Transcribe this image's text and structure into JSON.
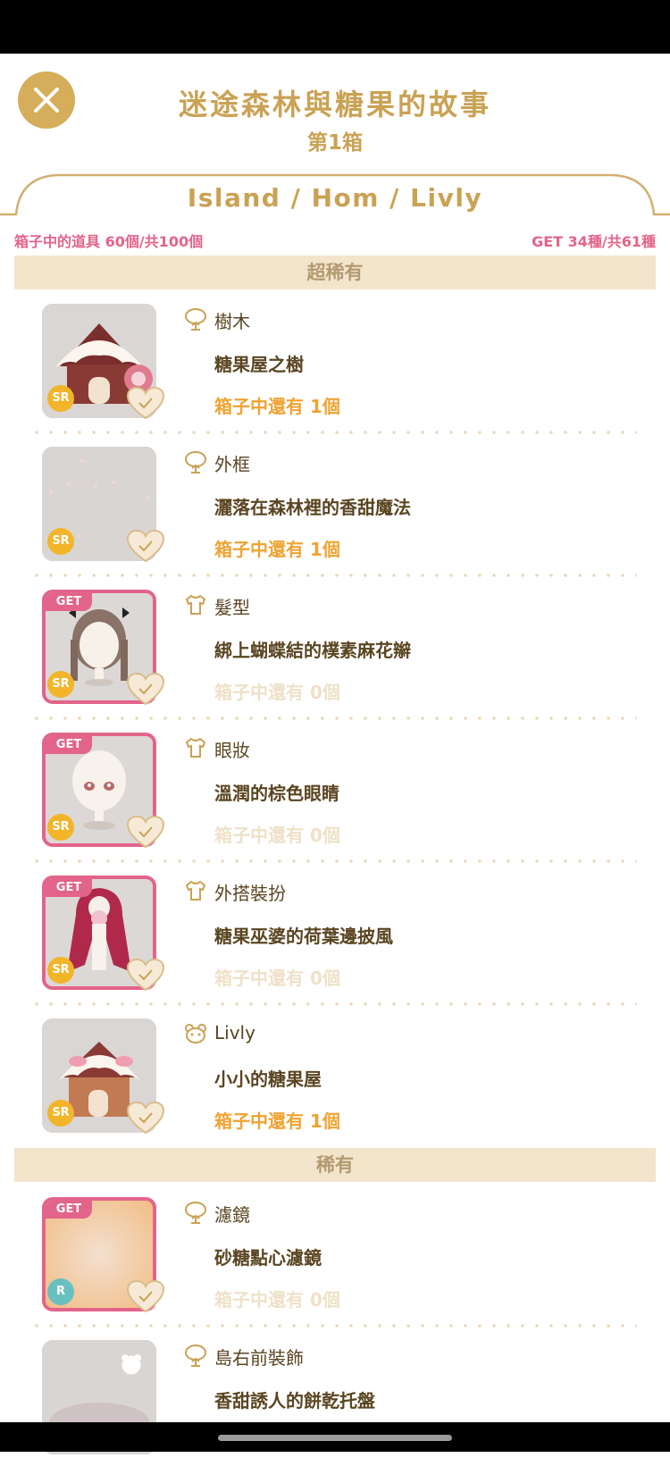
{
  "header": {
    "title": "迷途森林與糖果的故事",
    "subtitle": "第1箱",
    "tabs": "Island / Hom / Livly",
    "box_count": "箱子中的道具 60個/共100個",
    "get_count": "GET 34種/共61種"
  },
  "sections": {
    "super_rare": "超稀有",
    "rare": "稀有"
  },
  "items": [
    {
      "category": "樹木",
      "category_icon": "tree-icon",
      "name": "糖果屋之樹",
      "stock": "箱子中還有 1個",
      "rarity": "SR",
      "get": false,
      "get_label": ""
    },
    {
      "category": "外框",
      "category_icon": "tree-icon",
      "name": "灑落在森林裡的香甜魔法",
      "stock": "箱子中還有 1個",
      "rarity": "SR",
      "get": false,
      "get_label": ""
    },
    {
      "category": "髮型",
      "category_icon": "shirt-icon",
      "name": "綁上蝴蝶結的樸素麻花辮",
      "stock": "箱子中還有 0個",
      "rarity": "SR",
      "get": true,
      "get_label": "GET"
    },
    {
      "category": "眼妝",
      "category_icon": "shirt-icon",
      "name": "溫潤的棕色眼睛",
      "stock": "箱子中還有 0個",
      "rarity": "SR",
      "get": true,
      "get_label": "GET"
    },
    {
      "category": "外搭裝扮",
      "category_icon": "shirt-icon",
      "name": "糖果巫婆的荷葉邊披風",
      "stock": "箱子中還有 0個",
      "rarity": "SR",
      "get": true,
      "get_label": "GET"
    },
    {
      "category": "Livly",
      "category_icon": "livly-face-icon",
      "name": "小小的糖果屋",
      "stock": "箱子中還有 1個",
      "rarity": "SR",
      "get": false,
      "get_label": ""
    },
    {
      "category": "濾鏡",
      "category_icon": "tree-icon",
      "name": "砂糖點心濾鏡",
      "stock": "箱子中還有 0個",
      "rarity": "R",
      "get": true,
      "get_label": "GET"
    },
    {
      "category": "島右前裝飾",
      "category_icon": "tree-icon",
      "name": "香甜誘人的餅乾托盤",
      "stock": "",
      "rarity": "",
      "get": false,
      "get_label": ""
    }
  ],
  "colors": {
    "gold": "#c9a254",
    "pink": "#e3648a",
    "orange": "#efa331",
    "section_bg": "#f3e4cc"
  }
}
